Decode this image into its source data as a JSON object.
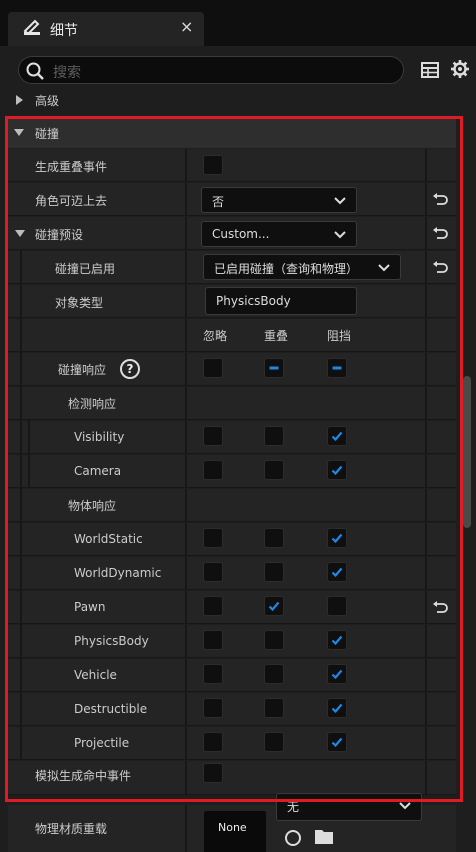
{
  "tab": {
    "title": "细节",
    "close": "×"
  },
  "search": {
    "placeholder": "搜索"
  },
  "advanced": {
    "label": "高级"
  },
  "collision": {
    "section_label": "碰撞",
    "generate_overlap": {
      "label": "生成重叠事件",
      "checked": false
    },
    "can_step_up": {
      "label": "角色可迈上去",
      "value": "否"
    },
    "preset": {
      "label": "碰撞预设",
      "value": "Custom..."
    },
    "enabled": {
      "label": "碰撞已启用",
      "value": "已启用碰撞（查询和物理）"
    },
    "object_type": {
      "label": "对象类型",
      "value": "PhysicsBody"
    },
    "columns": [
      "忽略",
      "重叠",
      "阻挡"
    ],
    "response": {
      "label": "碰撞响应",
      "help": "?",
      "state": [
        "unchecked",
        "partial",
        "partial"
      ]
    },
    "trace_header": "检测响应",
    "trace_rows": [
      {
        "label": "Visibility",
        "state": "block"
      },
      {
        "label": "Camera",
        "state": "block"
      }
    ],
    "object_header": "物体响应",
    "object_rows": [
      {
        "label": "WorldStatic",
        "state": "block"
      },
      {
        "label": "WorldDynamic",
        "state": "block"
      },
      {
        "label": "Pawn",
        "state": "overlap"
      },
      {
        "label": "PhysicsBody",
        "state": "block"
      },
      {
        "label": "Vehicle",
        "state": "block"
      },
      {
        "label": "Destructible",
        "state": "block"
      },
      {
        "label": "Projectile",
        "state": "block"
      }
    ],
    "simulate_hit": {
      "label": "模拟生成命中事件",
      "checked": false
    }
  },
  "phys_material": {
    "label": "物理材质重载",
    "thumb": "None",
    "value": "无"
  },
  "colors": {
    "accent": "#1e88e5",
    "highlight": "#e01b24"
  }
}
